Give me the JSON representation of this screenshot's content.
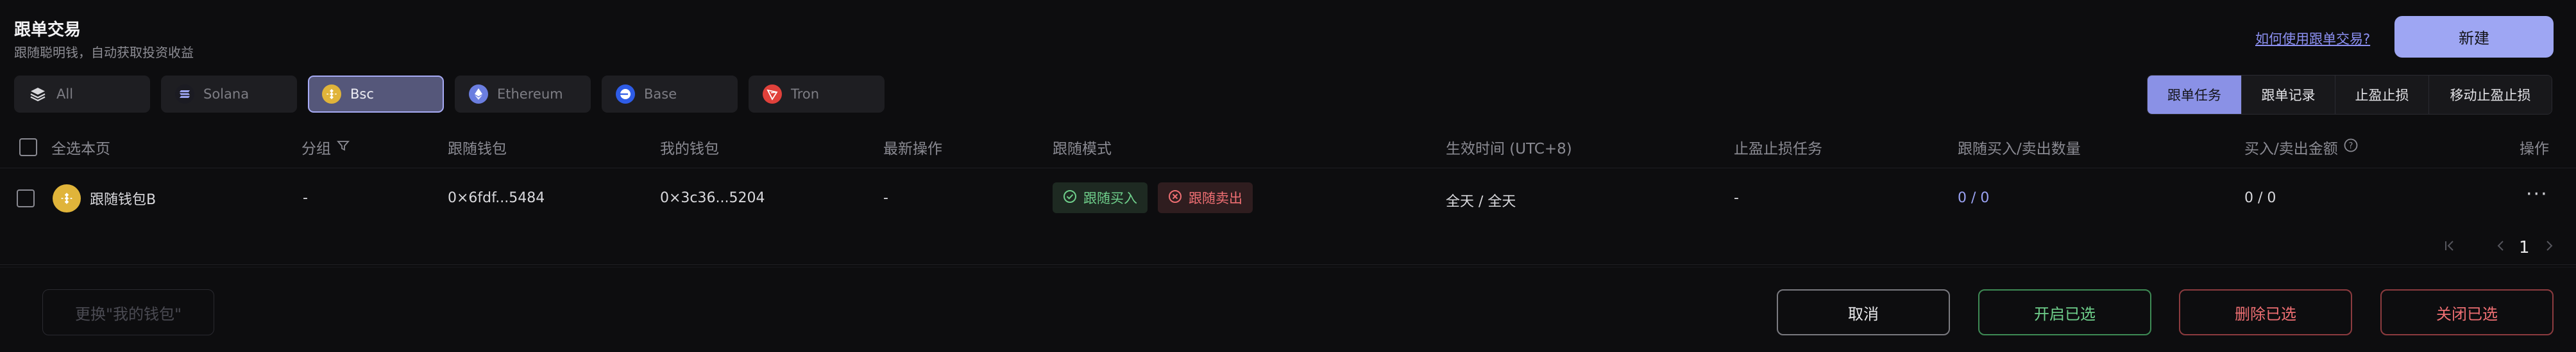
{
  "header": {
    "title": "跟单交易",
    "subtitle": "跟随聪明钱，自动获取投资收益",
    "help_link": "如何使用跟单交易?",
    "new_button": "新建"
  },
  "chains": [
    {
      "label": "All",
      "icon": "layers-icon",
      "active": false
    },
    {
      "label": "Solana",
      "icon": "solana-icon",
      "active": false
    },
    {
      "label": "Bsc",
      "icon": "bsc-icon",
      "active": true
    },
    {
      "label": "Ethereum",
      "icon": "ethereum-icon",
      "active": false
    },
    {
      "label": "Base",
      "icon": "base-icon",
      "active": false
    },
    {
      "label": "Tron",
      "icon": "tron-icon",
      "active": false
    }
  ],
  "tabs": [
    {
      "label": "跟单任务",
      "active": true
    },
    {
      "label": "跟单记录",
      "active": false
    },
    {
      "label": "止盈止损",
      "active": false
    },
    {
      "label": "移动止盈止损",
      "active": false
    }
  ],
  "table": {
    "headers": {
      "select_all": "全选本页",
      "group": "分组",
      "follow_wallet": "跟随钱包",
      "my_wallet": "我的钱包",
      "latest_op": "最新操作",
      "follow_mode": "跟随模式",
      "effective_time": "生效时间 (UTC+8)",
      "tp_sl_task": "止盈止损任务",
      "buy_sell_qty": "跟随买入/卖出数量",
      "buy_sell_amount": "买入/卖出金额",
      "actions": "操作"
    },
    "rows": [
      {
        "name": "跟随钱包B",
        "group": "-",
        "follow_wallet": "0×6fdf...5484",
        "my_wallet": "0×3c36...5204",
        "latest_op": "-",
        "mode_buy": "跟随买入",
        "mode_sell": "跟随卖出",
        "effective_time": "全天 / 全天",
        "tp_sl": "-",
        "qty": "0 / 0",
        "amount": "0 / 0"
      }
    ]
  },
  "pagination": {
    "current": "1"
  },
  "footer": {
    "change_wallet": "更换\"我的钱包\"",
    "cancel": "取消",
    "enable_selected": "开启已选",
    "delete_selected": "删除已选",
    "close_selected": "关闭已选"
  },
  "colors": {
    "accent": "#9ea6f3",
    "buy": "#6fcf8b",
    "sell": "#ef6f73",
    "background": "#0d0d0f"
  }
}
